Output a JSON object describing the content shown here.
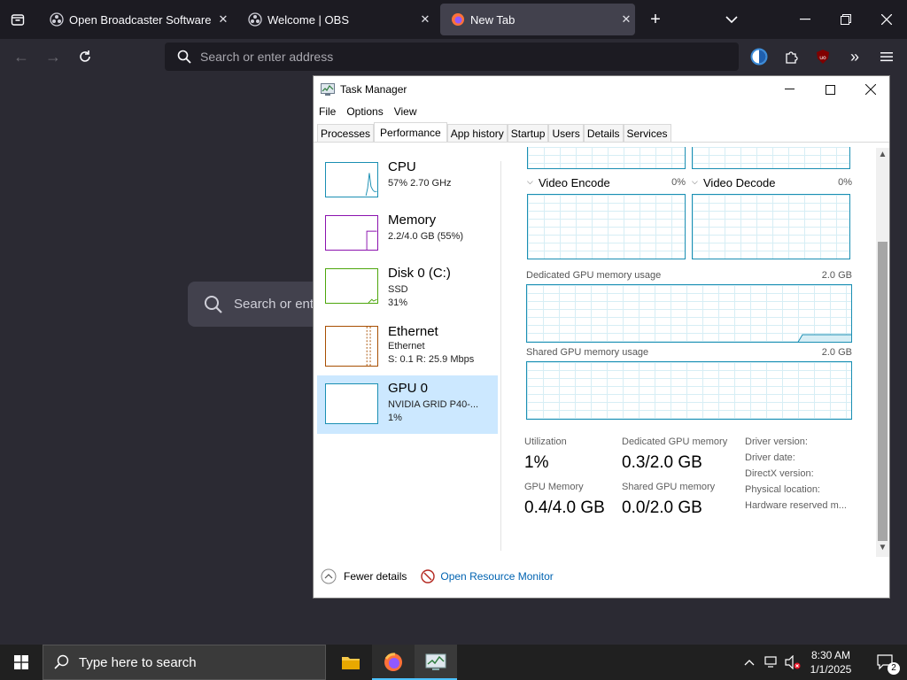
{
  "browser": {
    "tabs": [
      {
        "title": "Open Broadcaster Software | OB",
        "active": false
      },
      {
        "title": "Welcome | OBS",
        "active": false
      },
      {
        "title": "New Tab",
        "active": true
      }
    ],
    "address_placeholder": "Search or enter address",
    "newtab_search_placeholder": "Search or ent"
  },
  "task_manager": {
    "title": "Task Manager",
    "menu": [
      "File",
      "Options",
      "View"
    ],
    "tabs": [
      "Processes",
      "Performance",
      "App history",
      "Startup",
      "Users",
      "Details",
      "Services"
    ],
    "selected_tab": "Performance",
    "sidebar": [
      {
        "name": "CPU",
        "line1": "57% 2.70 GHz",
        "line2": "",
        "color": "#1a8fb3",
        "selected": false
      },
      {
        "name": "Memory",
        "line1": "2.2/4.0 GB (55%)",
        "line2": "",
        "color": "#8b12ae",
        "selected": false
      },
      {
        "name": "Disk 0 (C:)",
        "line1": "SSD",
        "line2": "31%",
        "color": "#4da60c",
        "selected": false
      },
      {
        "name": "Ethernet",
        "line1": "Ethernet",
        "line2": "S: 0.1  R: 25.9 Mbps",
        "color": "#a74f01",
        "selected": false
      },
      {
        "name": "GPU 0",
        "line1": "NVIDIA GRID P40-...",
        "line2": "1%",
        "color": "#1a8fb3",
        "selected": true
      }
    ],
    "engines": [
      {
        "name": "Video Encode",
        "pct": "0%"
      },
      {
        "name": "Video Decode",
        "pct": "0%"
      }
    ],
    "dedicated_graph": {
      "label": "Dedicated GPU memory usage",
      "max": "2.0 GB"
    },
    "shared_graph": {
      "label": "Shared GPU memory usage",
      "max": "2.0 GB"
    },
    "stats": {
      "utilization_label": "Utilization",
      "utilization": "1%",
      "dedicated_label": "Dedicated GPU memory",
      "dedicated": "0.3/2.0 GB",
      "gpu_memory_label": "GPU Memory",
      "gpu_memory": "0.4/4.0 GB",
      "shared_label": "Shared GPU memory",
      "shared": "0.0/2.0 GB"
    },
    "info_labels": [
      "Driver version:",
      "Driver date:",
      "DirectX version:",
      "Physical location:",
      "Hardware reserved m..."
    ],
    "footer": {
      "fewer": "Fewer details",
      "resource_monitor": "Open Resource Monitor"
    }
  },
  "taskbar": {
    "search_placeholder": "Type here to search",
    "time": "8:30 AM",
    "date": "1/1/2025",
    "notification_count": "2"
  }
}
